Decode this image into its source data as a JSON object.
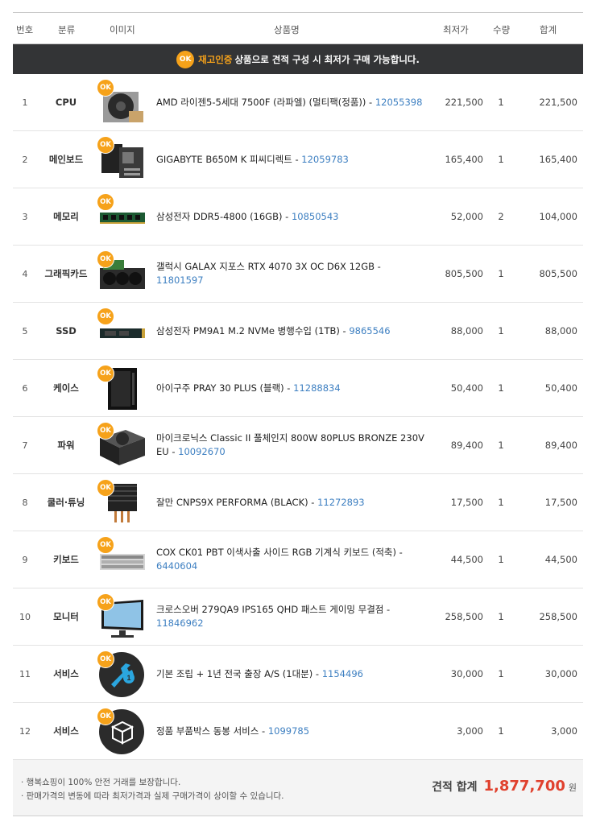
{
  "headers": {
    "no": "번호",
    "category": "분류",
    "image": "이미지",
    "name": "상품명",
    "price": "최저가",
    "qty": "수량",
    "sum": "합계"
  },
  "banner": {
    "badge": "OK",
    "highlight": "재고인증",
    "text": "상품으로 견적 구성 시 최저가 구매 가능합니다."
  },
  "ok_label": "OK",
  "accent_color": "#f6a21a",
  "link_color": "#3d7fc1",
  "total_color": "#e0412e",
  "items": [
    {
      "no": "1",
      "category": "CPU",
      "name": "AMD 라이젠5-5세대 7500F (라파엘) (멀티팩(정품))",
      "code": "12055398",
      "price": "221,500",
      "qty": "1",
      "sum": "221,500",
      "icon": "cpu-cooler-icon"
    },
    {
      "no": "2",
      "category": "메인보드",
      "name": "GIGABYTE B650M K 피씨디렉트",
      "code": "12059783",
      "price": "165,400",
      "qty": "1",
      "sum": "165,400",
      "icon": "motherboard-icon"
    },
    {
      "no": "3",
      "category": "메모리",
      "name": "삼성전자 DDR5-4800 (16GB)",
      "code": "10850543",
      "price": "52,000",
      "qty": "2",
      "sum": "104,000",
      "icon": "memory-stick-icon"
    },
    {
      "no": "4",
      "category": "그래픽카드",
      "name": "갤럭시 GALAX 지포스 RTX 4070 3X OC D6X 12GB",
      "code": "11801597",
      "price": "805,500",
      "qty": "1",
      "sum": "805,500",
      "icon": "graphics-card-icon"
    },
    {
      "no": "5",
      "category": "SSD",
      "name": "삼성전자 PM9A1 M.2 NVMe 병행수입 (1TB)",
      "code": "9865546",
      "price": "88,000",
      "qty": "1",
      "sum": "88,000",
      "icon": "ssd-icon"
    },
    {
      "no": "6",
      "category": "케이스",
      "name": "아이구주 PRAY 30 PLUS (블랙)",
      "code": "11288834",
      "price": "50,400",
      "qty": "1",
      "sum": "50,400",
      "icon": "pc-case-icon"
    },
    {
      "no": "7",
      "category": "파워",
      "name": "마이크로닉스 Classic II 풀체인지 800W 80PLUS BRONZE 230V EU",
      "code": "10092670",
      "price": "89,400",
      "qty": "1",
      "sum": "89,400",
      "icon": "power-supply-icon"
    },
    {
      "no": "8",
      "category": "쿨러·튜닝",
      "name": "잘만 CNPS9X PERFORMA (BLACK)",
      "code": "11272893",
      "price": "17,500",
      "qty": "1",
      "sum": "17,500",
      "icon": "tower-cooler-icon"
    },
    {
      "no": "9",
      "category": "키보드",
      "name": "COX CK01 PBT 이색사출 사이드 RGB 기계식 키보드 (적축)",
      "code": "6440604",
      "price": "44,500",
      "qty": "1",
      "sum": "44,500",
      "icon": "keyboard-icon"
    },
    {
      "no": "10",
      "category": "모니터",
      "name": "크로스오버 279QA9 IPS165 QHD 패스트 게이밍 무결점",
      "code": "11846962",
      "price": "258,500",
      "qty": "1",
      "sum": "258,500",
      "icon": "monitor-icon"
    },
    {
      "no": "11",
      "category": "서비스",
      "name": "기본 조립 + 1년 전국 출장 A/S (1대분)",
      "code": "1154496",
      "price": "30,000",
      "qty": "1",
      "sum": "30,000",
      "icon": "wrench-service-icon"
    },
    {
      "no": "12",
      "category": "서비스",
      "name": "정품 부품박스 동봉 서비스",
      "code": "1099785",
      "price": "3,000",
      "qty": "1",
      "sum": "3,000",
      "icon": "box-service-icon"
    }
  ],
  "footer": {
    "note1": "· 행복쇼핑이 100% 안전 거래를 보장합니다.",
    "note2": "· 판매가격의 변동에 따라 최저가격과 실제 구매가격이 상이할 수 있습니다.",
    "total_label": "견적 합계",
    "total_value": "1,877,700",
    "total_unit": "원"
  }
}
